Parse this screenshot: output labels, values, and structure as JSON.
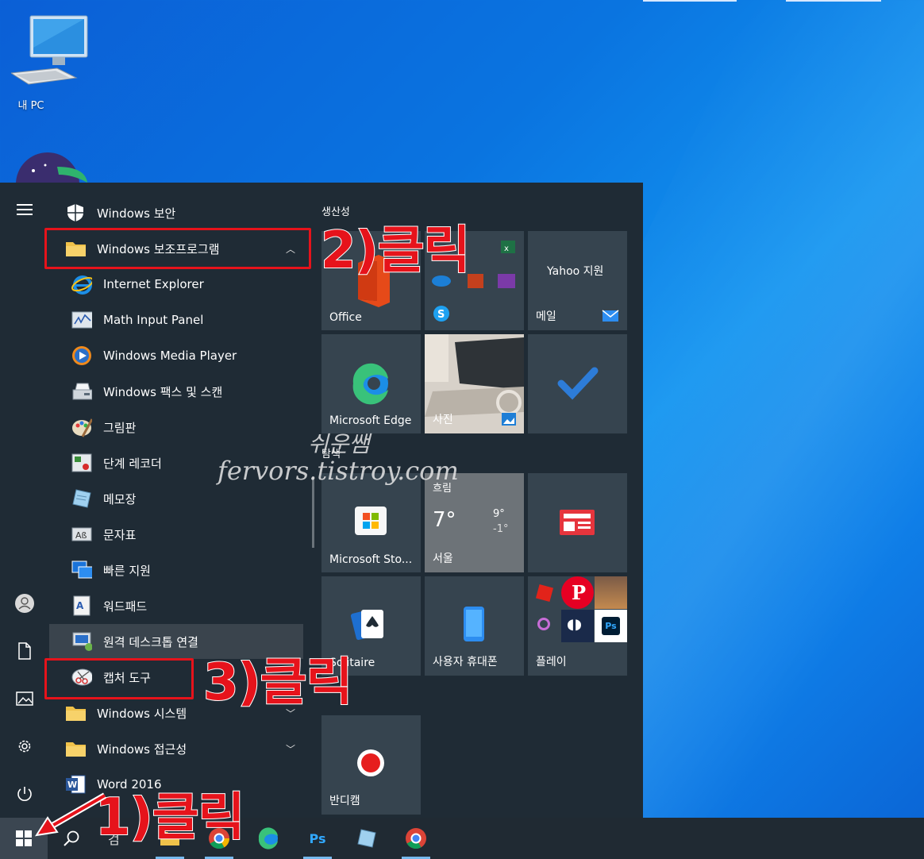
{
  "desktop": {
    "icons": [
      {
        "label": "내 PC"
      }
    ]
  },
  "rail": {
    "items": [
      "menu",
      "user",
      "documents",
      "pictures",
      "settings",
      "power"
    ]
  },
  "applist": {
    "items": [
      {
        "label": "Windows 보안",
        "icon": "shield-icon",
        "level": "top"
      },
      {
        "label": "Windows 보조프로그램",
        "icon": "folder-icon",
        "level": "top",
        "chevron": "^"
      },
      {
        "label": "Internet Explorer",
        "icon": "ie-icon",
        "level": "sub"
      },
      {
        "label": "Math Input Panel",
        "icon": "math-icon",
        "level": "sub"
      },
      {
        "label": "Windows Media Player",
        "icon": "media-player-icon",
        "level": "sub"
      },
      {
        "label": "Windows 팩스 및 스캔",
        "icon": "fax-icon",
        "level": "sub"
      },
      {
        "label": "그림판",
        "icon": "paint-icon",
        "level": "sub"
      },
      {
        "label": "단계 레코더",
        "icon": "recorder-icon",
        "level": "sub"
      },
      {
        "label": "메모장",
        "icon": "notepad-icon",
        "level": "sub"
      },
      {
        "label": "문자표",
        "icon": "charmap-icon",
        "level": "sub"
      },
      {
        "label": "빠른 지원",
        "icon": "quick-assist-icon",
        "level": "sub"
      },
      {
        "label": "워드패드",
        "icon": "wordpad-icon",
        "level": "sub"
      },
      {
        "label": "원격 데스크톱 연결",
        "icon": "remote-desktop-icon",
        "level": "sub"
      },
      {
        "label": "캡처 도구",
        "icon": "snipping-tool-icon",
        "level": "sub"
      },
      {
        "label": "Windows 시스템",
        "icon": "folder-icon",
        "level": "top",
        "chevron": "v"
      },
      {
        "label": "Windows 접근성",
        "icon": "folder-icon",
        "level": "top",
        "chevron": "v"
      },
      {
        "label": "Word 2016",
        "icon": "word-icon",
        "level": "top"
      }
    ]
  },
  "tiles": {
    "group1_title": "생산성",
    "group2_title": "탐색",
    "office": "Office",
    "yahoo": "Yahoo 지원",
    "mail": "메일",
    "edge": "Microsoft Edge",
    "photos": "사진",
    "store": "Microsoft Sto...",
    "weather_cond": "흐림",
    "weather_temp": "7°",
    "weather_high": "9°",
    "weather_low": "-1°",
    "weather_city": "서울",
    "solitaire": "Solitaire",
    "phone": "사용자 휴대폰",
    "play": "플레이",
    "bandicam": "반디캠"
  },
  "taskbar": {
    "search_label": "검"
  },
  "annotations": {
    "step1": "1)클릭",
    "step2": "2)클릭",
    "step3": "3)클릭",
    "watermark_name": "쉬운쌤",
    "watermark_site": "fervors.tistroy.com"
  },
  "colors": {
    "start_bg": "#1f2b35",
    "tile_bg": "#36444f",
    "annotation_red": "#e6131b",
    "accent": "#76b9ed"
  }
}
